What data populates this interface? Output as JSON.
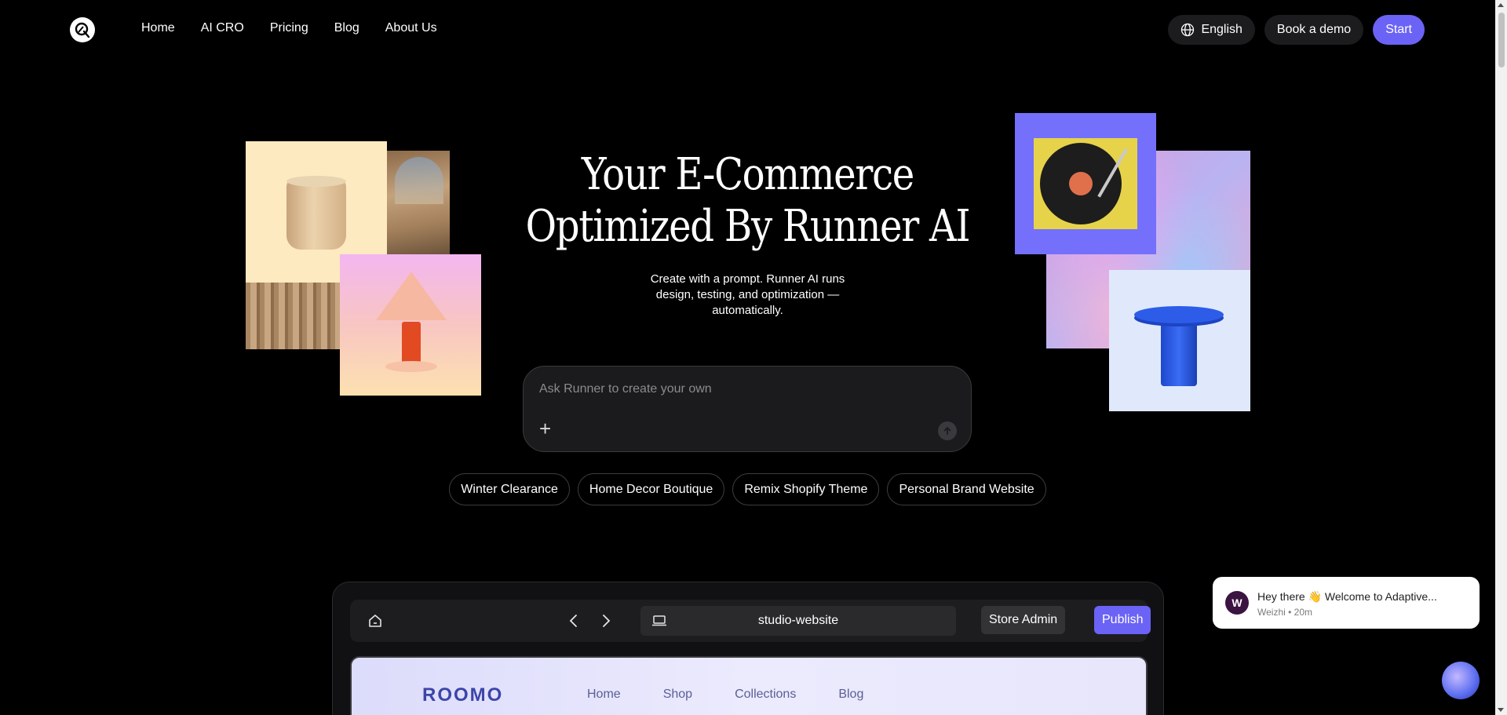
{
  "nav": {
    "links": [
      "Home",
      "AI CRO",
      "Pricing",
      "Blog",
      "About Us"
    ],
    "language": "English",
    "demo": "Book a demo",
    "start": "Start"
  },
  "hero": {
    "title_line1": "Your E-Commerce",
    "title_line2": "Optimized By Runner AI",
    "subtitle": "Create with a prompt. Runner AI runs design, testing, and optimization — automatically."
  },
  "prompt": {
    "placeholder": "Ask Runner to create your own"
  },
  "chips": [
    "Winter Clearance",
    "Home Decor Boutique",
    "Remix Shopify Theme",
    "Personal Brand Website"
  ],
  "mockup": {
    "url": "studio-website",
    "store_admin": "Store Admin",
    "publish": "Publish",
    "site_brand": "ROOMO",
    "site_nav": [
      "Home",
      "Shop",
      "Collections",
      "Blog"
    ]
  },
  "chat": {
    "avatar_letter": "W",
    "message": "Hey there 👋 Welcome to Adaptive...",
    "meta": "Weizhi • 20m"
  },
  "colors": {
    "accent": "#6b63f5",
    "background": "#000000"
  }
}
